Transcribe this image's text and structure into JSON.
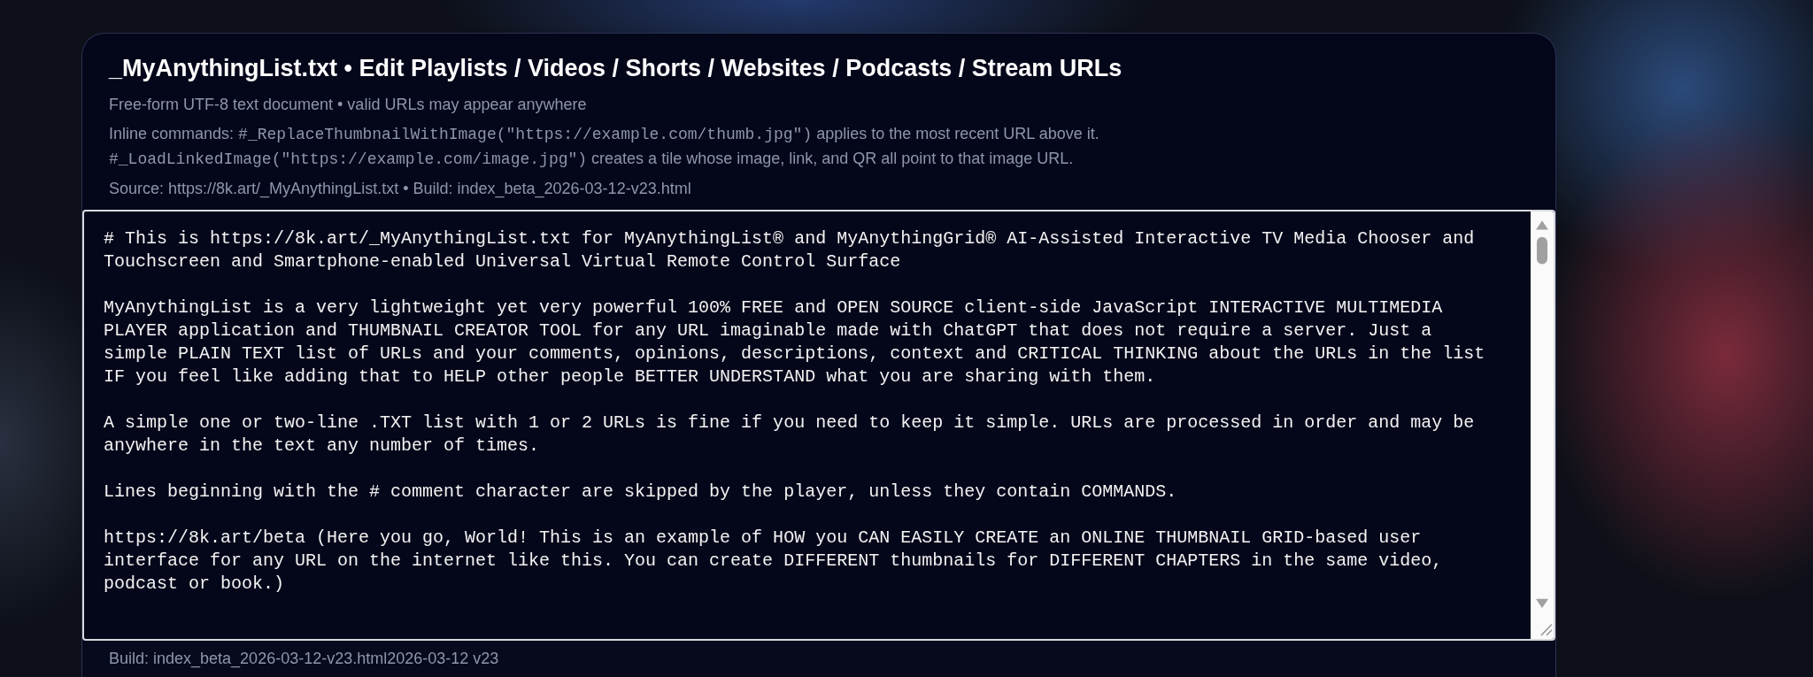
{
  "header": {
    "title": "_MyAnythingList.txt • Edit Playlists / Videos / Shorts / Websites / Podcasts / Stream URLs",
    "subtitle": "Free-form UTF-8 text document • valid URLs may appear anywhere",
    "commands": [
      {
        "kind": "plain",
        "text": "Inline commands: "
      },
      {
        "kind": "code",
        "text": "#_ReplaceThumbnailWithImage(\"https://example.com/thumb.jpg\")"
      },
      {
        "kind": "plain",
        "text": " applies to the most recent URL above it."
      },
      {
        "kind": "break"
      },
      {
        "kind": "code",
        "text": "#_LoadLinkedImage(\"https://example.com/image.jpg\")"
      },
      {
        "kind": "plain",
        "text": " creates a tile whose image, link, and QR all point to that image URL."
      }
    ],
    "source": "Source: https://8k.art/_MyAnythingList.txt • Build: index_beta_2026-03-12-v23.html"
  },
  "editor": {
    "paragraphs": [
      {
        "lines": [
          "# This is https://8k.art/_MyAnythingList.txt for MyAnythingList® and MyAnythingGrid® AI-Assisted Interactive TV Media Chooser and",
          "Touchscreen and Smartphone-enabled Universal Virtual Remote Control Surface"
        ]
      },
      {
        "lines": [
          "MyAnythingList is a very lightweight yet very powerful 100% FREE and OPEN SOURCE client-side JavaScript INTERACTIVE MULTIMEDIA",
          "PLAYER application and THUMBNAIL CREATOR TOOL for any URL imaginable made with ChatGPT that does not require a server. Just a",
          "simple PLAIN TEXT list of URLs and your comments, opinions, descriptions, context and CRITICAL THINKING about the URLs in the list",
          "IF you feel like adding that to HELP other people BETTER UNDERSTAND what you are sharing with them."
        ]
      },
      {
        "lines": [
          "A simple one or two-line .TXT list with 1 or 2 URLs is fine if you need to keep it simple. URLs are processed in order and may be",
          "anywhere in the text any number of times."
        ]
      },
      {
        "lines": [
          "Lines beginning with the # comment character are skipped by the player, unless they contain COMMANDS."
        ]
      },
      {
        "lines": [
          "https://8k.art/beta (Here you go, World! This is an example of HOW you CAN EASILY CREATE an ONLINE THUMBNAIL GRID-based user",
          "interface for any URL on the internet like this. You can create DIFFERENT thumbnails for DIFFERENT CHAPTERS in the same video,",
          "podcast or book.)"
        ]
      }
    ]
  },
  "footer": {
    "text": "Build: index_beta_2026-03-12-v23.html2026-03-12 v23"
  }
}
